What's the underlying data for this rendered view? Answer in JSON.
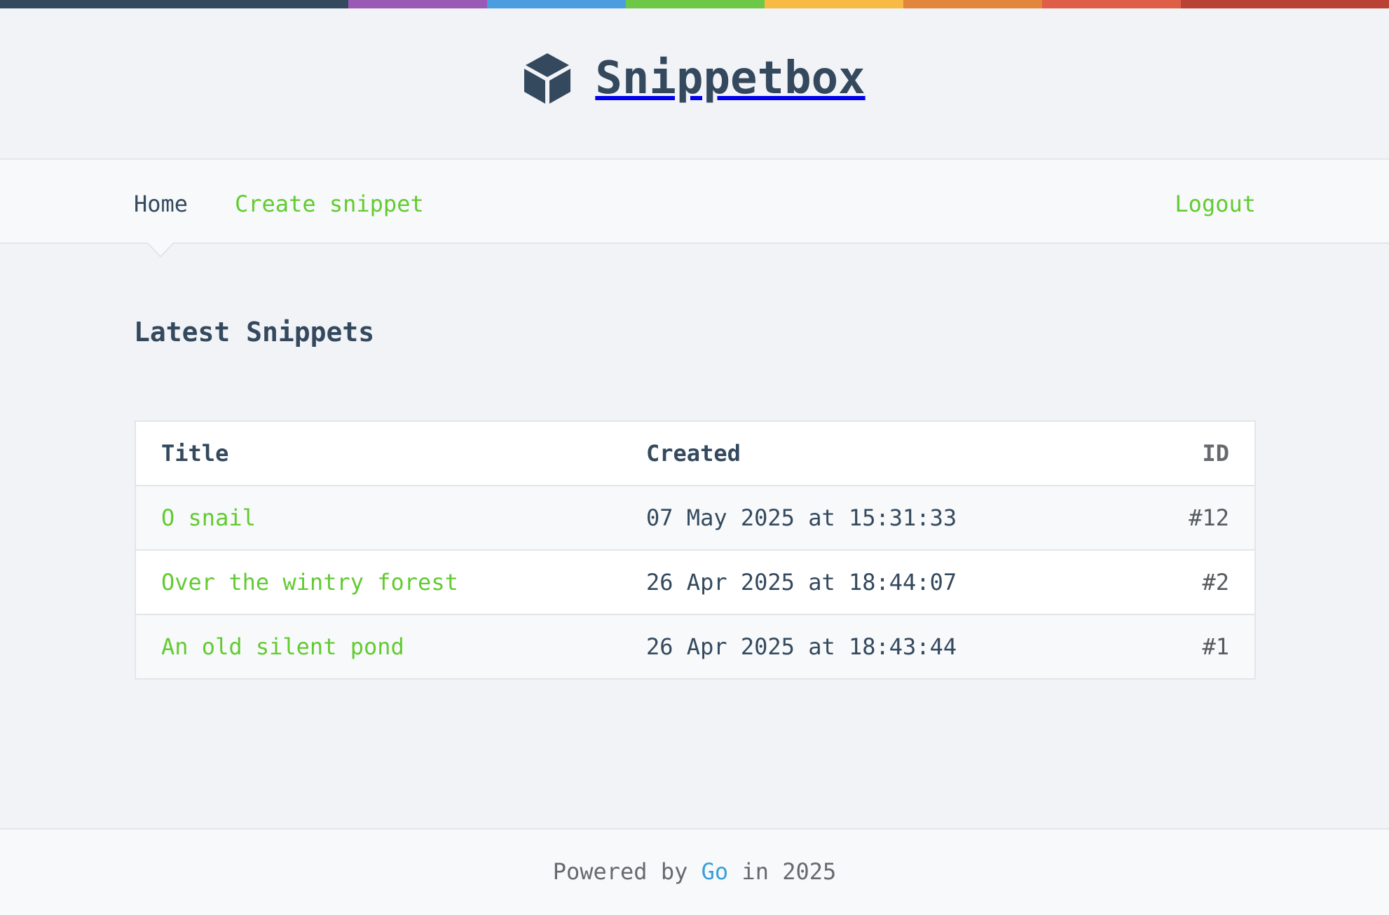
{
  "brand": {
    "title": "Snippetbox",
    "icon": "cube-icon"
  },
  "colors": {
    "stripe": [
      "#34495e",
      "#9b59b6",
      "#4a9ee0",
      "#6dc847",
      "#f7bb45",
      "#e2853d",
      "#df5e47",
      "#b94234"
    ],
    "accent": "#62cb31",
    "text": "#34495e",
    "footer_link": "#3a9fd8"
  },
  "nav": {
    "home_label": "Home",
    "create_label": "Create snippet",
    "logout_label": "Logout"
  },
  "main": {
    "heading": "Latest Snippets",
    "table": {
      "headers": {
        "title": "Title",
        "created": "Created",
        "id": "ID"
      },
      "rows": [
        {
          "title": "O snail",
          "created": "07 May 2025 at 15:31:33",
          "id": "#12"
        },
        {
          "title": "Over the wintry forest",
          "created": "26 Apr 2025 at 18:44:07",
          "id": "#2"
        },
        {
          "title": "An old silent pond",
          "created": "26 Apr 2025 at 18:43:44",
          "id": "#1"
        }
      ]
    }
  },
  "footer": {
    "prefix": "Powered by ",
    "link": "Go",
    "suffix": " in 2025"
  }
}
